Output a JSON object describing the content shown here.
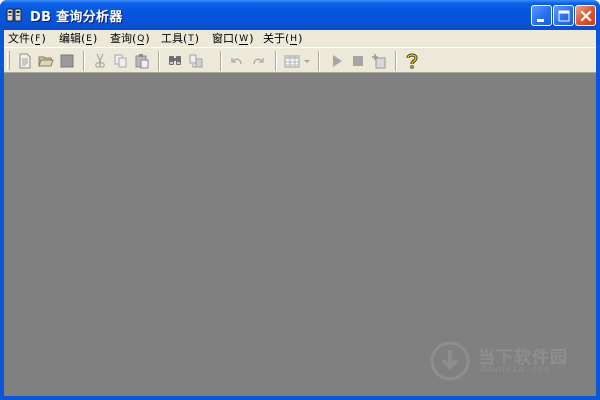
{
  "window": {
    "title": "DB 查询分析器",
    "icon": "app-database-icon"
  },
  "title_buttons": {
    "minimize": "minimize-icon",
    "maximize": "maximize-icon",
    "close": "close-icon"
  },
  "menu": {
    "items": [
      {
        "label": "文件",
        "key": "F",
        "lp": "(",
        "rp": ")"
      },
      {
        "label": "编辑",
        "key": "E",
        "lp": "(",
        "rp": ")"
      },
      {
        "label": "查询",
        "key": "Q",
        "lp": "(",
        "rp": ")"
      },
      {
        "label": "工具",
        "key": "T",
        "lp": "(",
        "rp": ")"
      },
      {
        "label": "窗口",
        "key": "W",
        "lp": "(",
        "rp": ")"
      },
      {
        "label": "关于",
        "key": "H",
        "lp": "(",
        "rp": ")"
      }
    ]
  },
  "toolbar": {
    "tools": [
      "new-query-icon",
      "open-folder-icon",
      "save-icon",
      "cut-icon",
      "copy-icon",
      "paste-icon",
      "find-icon",
      "replace-icon",
      "undo-icon",
      "redo-icon",
      "grid-results-icon",
      "dropdown-arrow-icon",
      "execute-icon",
      "stop-icon",
      "parse-icon",
      "help-icon"
    ]
  },
  "watermark": {
    "text": "当下软件园",
    "sub": "downxia.com"
  },
  "colors": {
    "titlebar": "#0555dd",
    "frame": "#0a58d8",
    "menubar": "#ece9d8",
    "workspace": "#808080"
  }
}
